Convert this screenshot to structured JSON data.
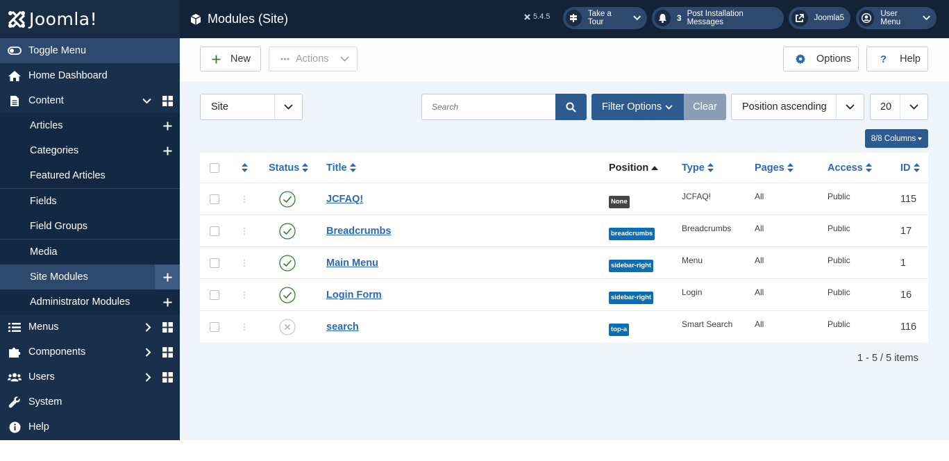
{
  "brand": {
    "name": "Joomla!"
  },
  "header": {
    "title": "Modules (Site)",
    "version": "5.4.5",
    "take_tour": "Take a Tour",
    "post_install_count": "3",
    "post_install": "Post Installation Messages",
    "site_link": "Joomla5",
    "user_menu": "User Menu"
  },
  "sidebar": {
    "toggle": "Toggle Menu",
    "home": "Home Dashboard",
    "content": "Content",
    "content_items": [
      "Articles",
      "Categories",
      "Featured Articles",
      "Fields",
      "Field Groups",
      "Media",
      "Site Modules",
      "Administrator Modules"
    ],
    "menus": "Menus",
    "components": "Components",
    "users": "Users",
    "system": "System",
    "help": "Help"
  },
  "toolbar": {
    "new": "New",
    "actions": "Actions",
    "options": "Options",
    "help": "Help"
  },
  "filters": {
    "client": "Site",
    "search_placeholder": "Search",
    "filter_options": "Filter Options",
    "clear": "Clear",
    "ordering": "Position ascending",
    "limit": "20",
    "columns": "8/8 Columns"
  },
  "table": {
    "headers": {
      "status": "Status",
      "title": "Title",
      "position": "Position",
      "type": "Type",
      "pages": "Pages",
      "access": "Access",
      "id": "ID"
    },
    "rows": [
      {
        "status": "published",
        "title": "JCFAQ!",
        "position": "None",
        "position_color": "#444444",
        "type": "JCFAQ!",
        "pages": "All",
        "access": "Public",
        "id": "115"
      },
      {
        "status": "published",
        "title": "Breadcrumbs",
        "position": "breadcrumbs",
        "position_color": "#0b6fb7",
        "type": "Breadcrumbs",
        "pages": "All",
        "access": "Public",
        "id": "17"
      },
      {
        "status": "published",
        "title": "Main Menu",
        "position": "sidebar-right",
        "position_color": "#0b6fb7",
        "type": "Menu",
        "pages": "All",
        "access": "Public",
        "id": "1"
      },
      {
        "status": "published",
        "title": "Login Form",
        "position": "sidebar-right",
        "position_color": "#0b6fb7",
        "type": "Login",
        "pages": "All",
        "access": "Public",
        "id": "16"
      },
      {
        "status": "unpublished",
        "title": "search",
        "position": "top-a",
        "position_color": "#0b6fb7",
        "type": "Smart Search",
        "pages": "All",
        "access": "Public",
        "id": "116"
      }
    ]
  },
  "pagination": {
    "summary": "1 - 5 / 5 items"
  }
}
